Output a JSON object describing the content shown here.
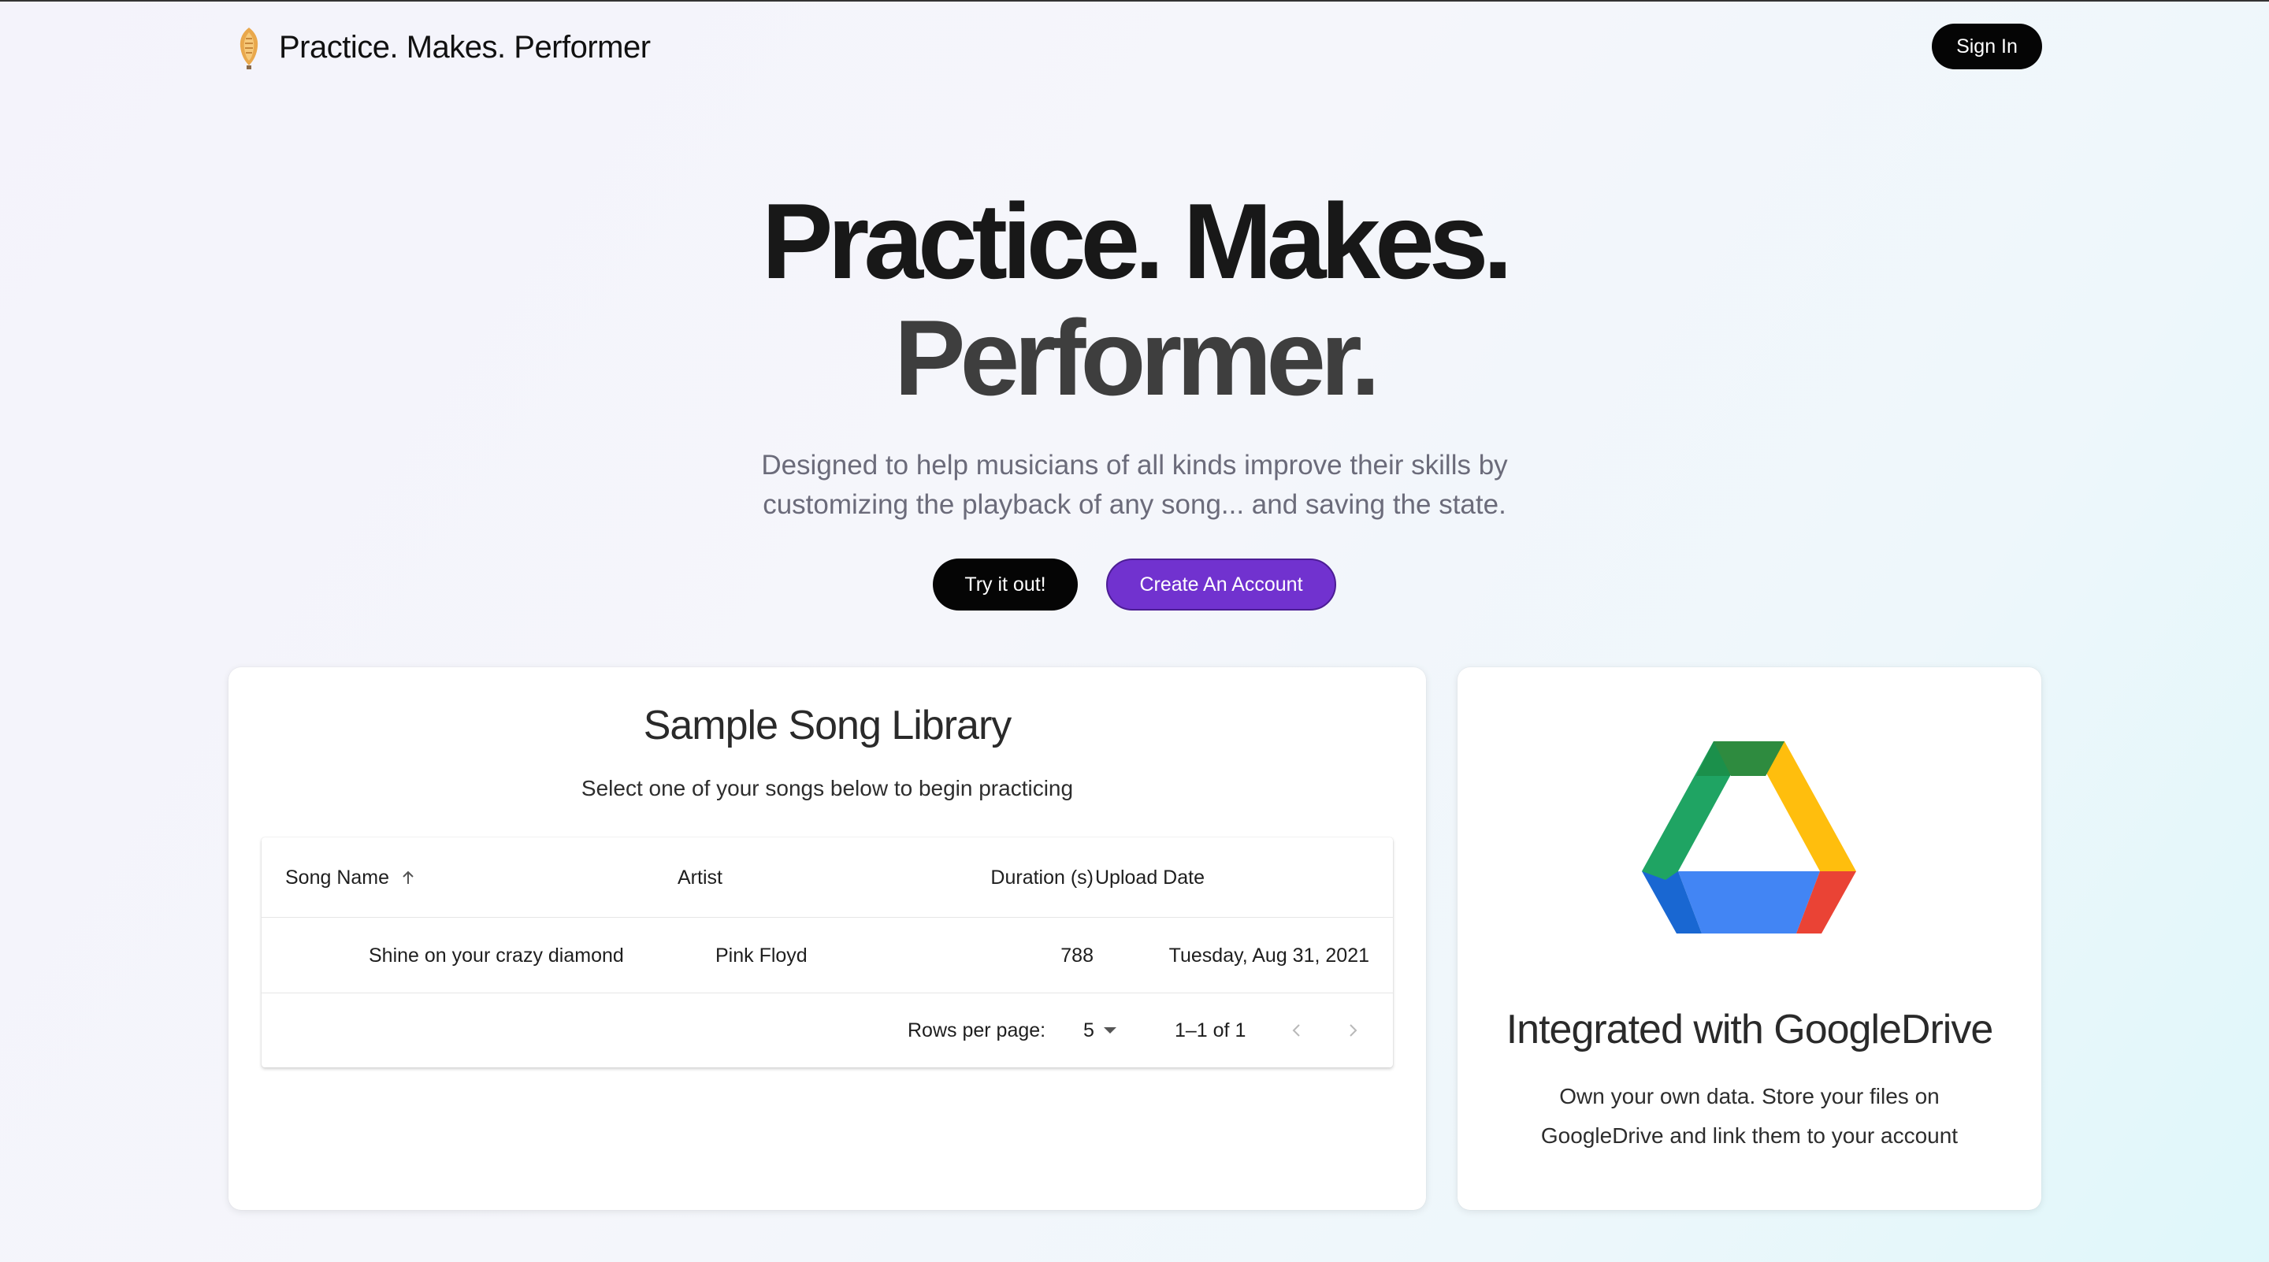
{
  "header": {
    "brand": "Practice. Makes. Performer",
    "sign_in": "Sign In"
  },
  "hero": {
    "title_line1": "Practice. Makes.",
    "title_line2": "Performer.",
    "subtitle": "Designed to help musicians of all kinds improve their skills by customizing the playback of any song... and saving the state.",
    "try_button": "Try it out!",
    "create_button": "Create An Account"
  },
  "library": {
    "title": "Sample Song Library",
    "subtitle": "Select one of your songs below to begin practicing",
    "columns": [
      "Song Name",
      "Artist",
      "Duration (s)",
      "Upload Date"
    ],
    "sort_column": "Song Name",
    "sort_direction": "ascending",
    "rows": [
      {
        "song": "Shine on your crazy diamond",
        "artist": "Pink Floyd",
        "duration": "788",
        "date": "Tuesday, Aug 31, 2021"
      }
    ],
    "pagination": {
      "rows_per_page_label": "Rows per page:",
      "rows_per_page": "5",
      "range": "1–1 of 1"
    }
  },
  "drive": {
    "title": "Integrated with GoogleDrive",
    "subtitle": "Own your own data. Store your files on GoogleDrive and link them to your account",
    "logo_icon": "google-drive-icon",
    "colors": {
      "green": "#1fa463",
      "dark_green": "#188038",
      "yellow": "#ffba00",
      "blue": "#4285f4",
      "dark_blue": "#1967d2",
      "red": "#ea4335"
    }
  },
  "colors": {
    "primary_black": "#050505",
    "accent_purple": "#7132cf"
  }
}
